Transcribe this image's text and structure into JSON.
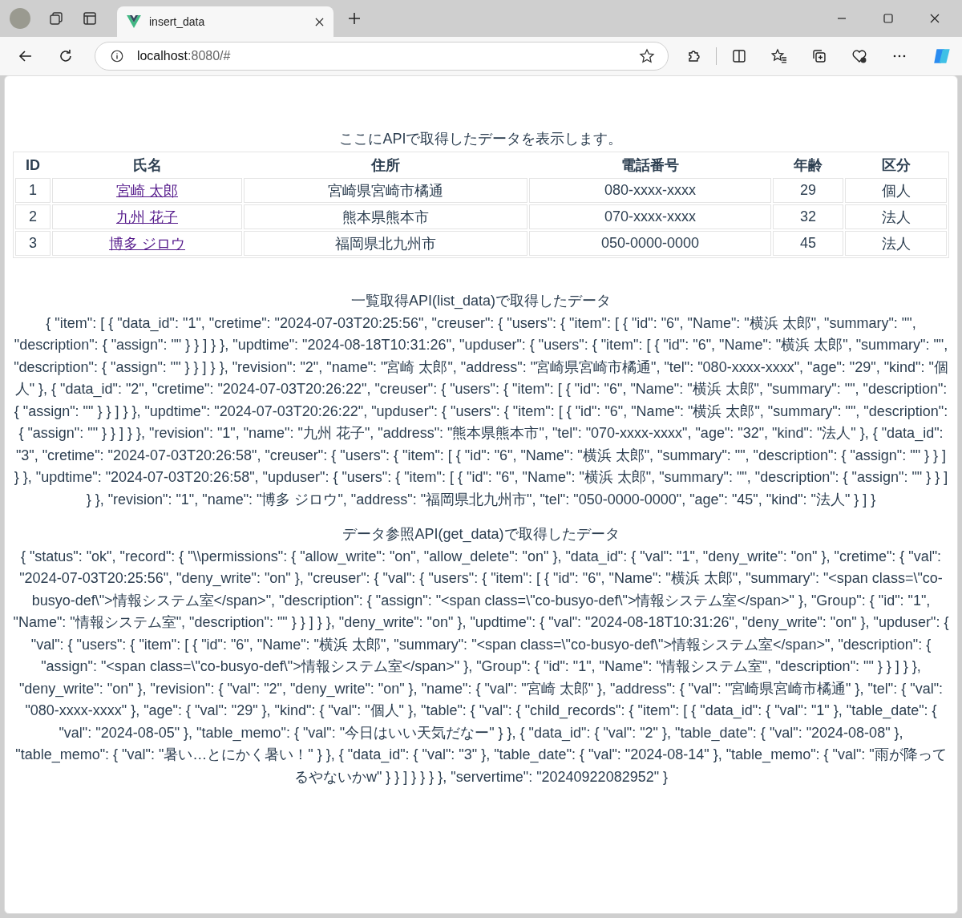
{
  "browser": {
    "tab_title": "insert_data",
    "address_host": "localhost",
    "address_rest": ":8080/#"
  },
  "intro": "ここにAPIで取得したデータを表示します。",
  "table": {
    "columns": [
      "ID",
      "氏名",
      "住所",
      "電話番号",
      "年齢",
      "区分"
    ],
    "rows": [
      {
        "id": "1",
        "name": "宮崎 太郎",
        "address": "宮崎県宮崎市橘通",
        "tel": "080-xxxx-xxxx",
        "age": "29",
        "kind": "個人"
      },
      {
        "id": "2",
        "name": "九州 花子",
        "address": "熊本県熊本市",
        "tel": "070-xxxx-xxxx",
        "age": "32",
        "kind": "法人"
      },
      {
        "id": "3",
        "name": "博多 ジロウ",
        "address": "福岡県北九州市",
        "tel": "050-0000-0000",
        "age": "45",
        "kind": "法人"
      }
    ]
  },
  "sections": [
    {
      "title": "一覧取得API(list_data)で取得したデータ",
      "body": "{ \"item\": [ { \"data_id\": \"1\", \"cretime\": \"2024-07-03T20:25:56\", \"creuser\": { \"users\": { \"item\": [ { \"id\": \"6\", \"Name\": \"横浜 太郎\", \"summary\": \"\", \"description\": { \"assign\": \"\" } } ] } }, \"updtime\": \"2024-08-18T10:31:26\", \"upduser\": { \"users\": { \"item\": [ { \"id\": \"6\", \"Name\": \"横浜 太郎\", \"summary\": \"\", \"description\": { \"assign\": \"\" } } ] } }, \"revision\": \"2\", \"name\": \"宮崎 太郎\", \"address\": \"宮崎県宮崎市橘通\", \"tel\": \"080-xxxx-xxxx\", \"age\": \"29\", \"kind\": \"個人\" }, { \"data_id\": \"2\", \"cretime\": \"2024-07-03T20:26:22\", \"creuser\": { \"users\": { \"item\": [ { \"id\": \"6\", \"Name\": \"横浜 太郎\", \"summary\": \"\", \"description\": { \"assign\": \"\" } } ] } }, \"updtime\": \"2024-07-03T20:26:22\", \"upduser\": { \"users\": { \"item\": [ { \"id\": \"6\", \"Name\": \"横浜 太郎\", \"summary\": \"\", \"description\": { \"assign\": \"\" } } ] } }, \"revision\": \"1\", \"name\": \"九州 花子\", \"address\": \"熊本県熊本市\", \"tel\": \"070-xxxx-xxxx\", \"age\": \"32\", \"kind\": \"法人\" }, { \"data_id\": \"3\", \"cretime\": \"2024-07-03T20:26:58\", \"creuser\": { \"users\": { \"item\": [ { \"id\": \"6\", \"Name\": \"横浜 太郎\", \"summary\": \"\", \"description\": { \"assign\": \"\" } } ] } }, \"updtime\": \"2024-07-03T20:26:58\", \"upduser\": { \"users\": { \"item\": [ { \"id\": \"6\", \"Name\": \"横浜 太郎\", \"summary\": \"\", \"description\": { \"assign\": \"\" } } ] } }, \"revision\": \"1\", \"name\": \"博多 ジロウ\", \"address\": \"福岡県北九州市\", \"tel\": \"050-0000-0000\", \"age\": \"45\", \"kind\": \"法人\" } ] }"
    },
    {
      "title": "データ参照API(get_data)で取得したデータ",
      "body": "{ \"status\": \"ok\", \"record\": { \"\\\\permissions\": { \"allow_write\": \"on\", \"allow_delete\": \"on\" }, \"data_id\": { \"val\": \"1\", \"deny_write\": \"on\" }, \"cretime\": { \"val\": \"2024-07-03T20:25:56\", \"deny_write\": \"on\" }, \"creuser\": { \"val\": { \"users\": { \"item\": [ { \"id\": \"6\", \"Name\": \"横浜 太郎\", \"summary\": \"<span class=\\\"co-busyo-def\\\">情報システム室</span>\", \"description\": { \"assign\": \"<span class=\\\"co-busyo-def\\\">情報システム室</span>\" }, \"Group\": { \"id\": \"1\", \"Name\": \"情報システム室\", \"description\": \"\" } } ] } }, \"deny_write\": \"on\" }, \"updtime\": { \"val\": \"2024-08-18T10:31:26\", \"deny_write\": \"on\" }, \"upduser\": { \"val\": { \"users\": { \"item\": [ { \"id\": \"6\", \"Name\": \"横浜 太郎\", \"summary\": \"<span class=\\\"co-busyo-def\\\">情報システム室</span>\", \"description\": { \"assign\": \"<span class=\\\"co-busyo-def\\\">情報システム室</span>\" }, \"Group\": { \"id\": \"1\", \"Name\": \"情報システム室\", \"description\": \"\" } } ] } }, \"deny_write\": \"on\" }, \"revision\": { \"val\": \"2\", \"deny_write\": \"on\" }, \"name\": { \"val\": \"宮崎 太郎\" }, \"address\": { \"val\": \"宮崎県宮崎市橘通\" }, \"tel\": { \"val\": \"080-xxxx-xxxx\" }, \"age\": { \"val\": \"29\" }, \"kind\": { \"val\": \"個人\" }, \"table\": { \"val\": { \"child_records\": { \"item\": [ { \"data_id\": { \"val\": \"1\" }, \"table_date\": { \"val\": \"2024-08-05\" }, \"table_memo\": { \"val\": \"今日はいい天気だなー\" } }, { \"data_id\": { \"val\": \"2\" }, \"table_date\": { \"val\": \"2024-08-08\" }, \"table_memo\": { \"val\": \"暑い…とにかく暑い！\" } }, { \"data_id\": { \"val\": \"3\" }, \"table_date\": { \"val\": \"2024-08-14\" }, \"table_memo\": { \"val\": \"雨が降ってるやないかw\" } } ] } } } }, \"servertime\": \"20240922082952\" }"
    }
  ]
}
